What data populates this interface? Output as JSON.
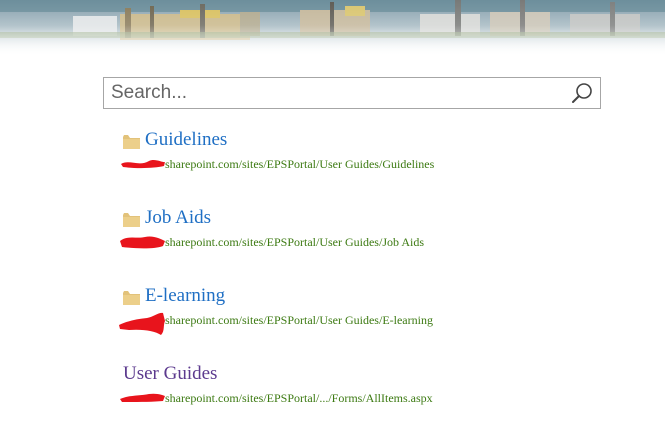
{
  "search": {
    "placeholder": "Search..."
  },
  "results": [
    {
      "title": "Guidelines",
      "icon": "folder-icon",
      "url": "sharepoint.com/sites/EPSPortal/User Guides/Guidelines"
    },
    {
      "title": "Job Aids",
      "icon": "folder-icon",
      "url": "sharepoint.com/sites/EPSPortal/User Guides/Job Aids"
    },
    {
      "title": "E-learning",
      "icon": "folder-icon",
      "url": "sharepoint.com/sites/EPSPortal/User Guides/E-learning"
    },
    {
      "title": "User Guides",
      "icon": null,
      "url": "sharepoint.com/sites/EPSPortal/.../Forms/AllItems.aspx"
    }
  ],
  "colors": {
    "link": "#1f6fc4",
    "visited_link": "#5c3a8e",
    "url": "#3c7a12",
    "redaction": "#e8141c",
    "folder": "#e2c27a"
  }
}
